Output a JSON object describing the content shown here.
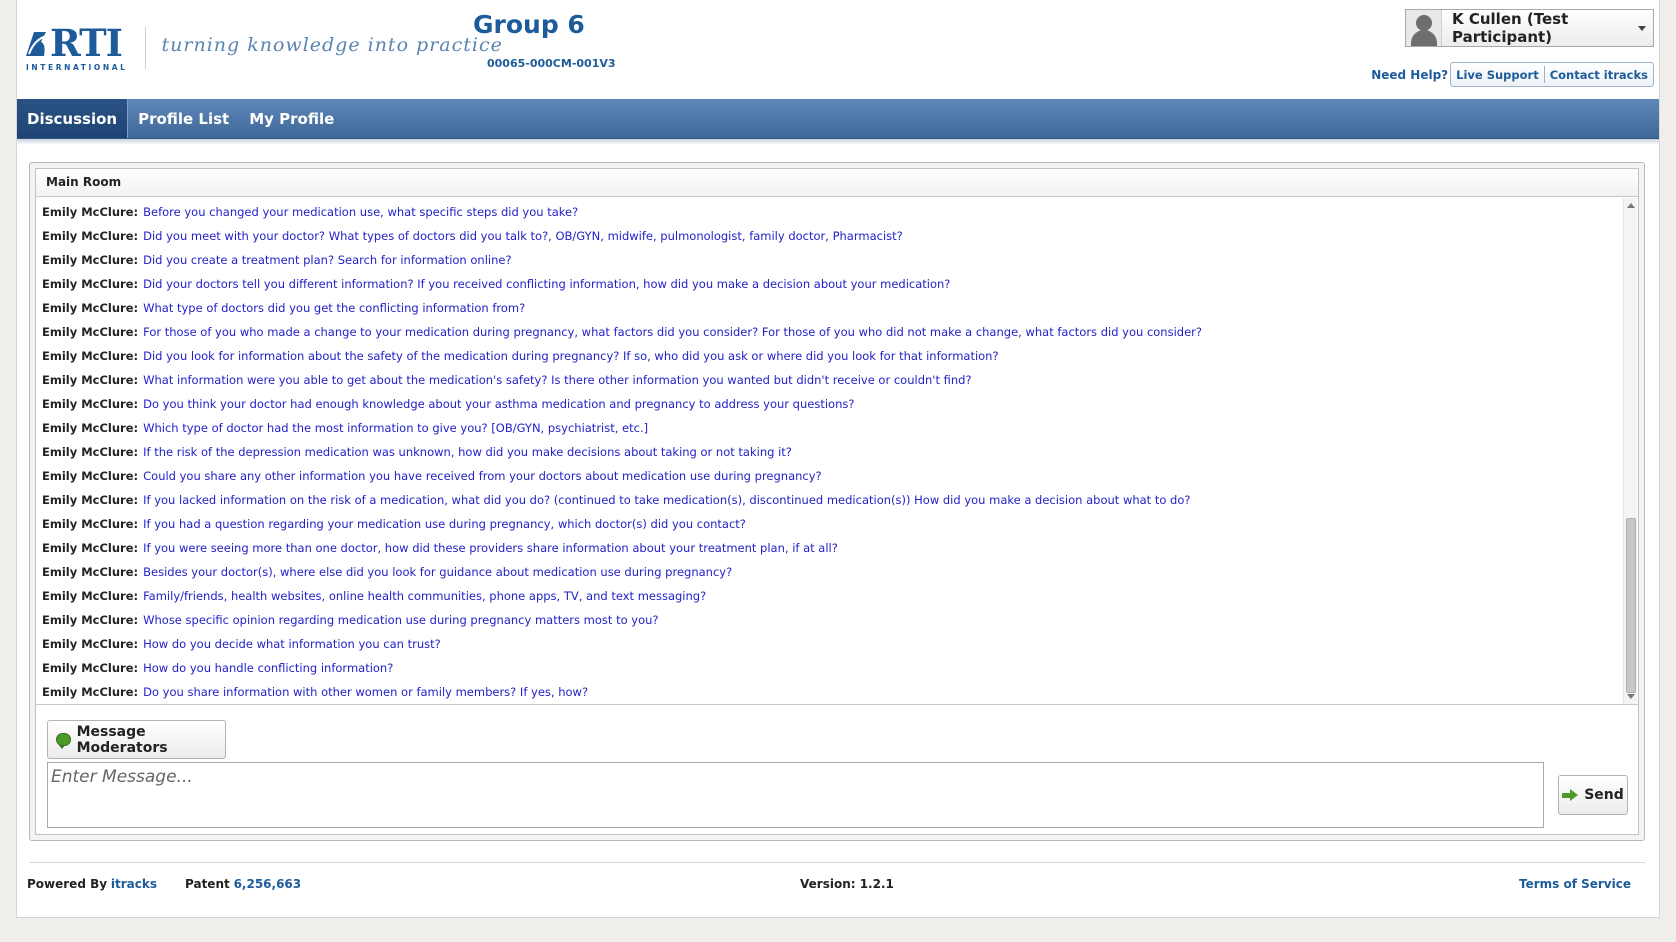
{
  "header": {
    "logo_text": "RTI",
    "logo_subtext": "INTERNATIONAL",
    "tagline": "turning knowledge into practice",
    "group_title": "Group 6",
    "group_code": "00065-000CM-001V3",
    "user_name": "K Cullen (Test Participant)",
    "need_help": "Need Help?",
    "live_support": "Live Support",
    "contact": "Contact itracks"
  },
  "nav": {
    "tabs": [
      {
        "label": "Discussion",
        "active": true
      },
      {
        "label": "Profile List",
        "active": false
      },
      {
        "label": "My Profile",
        "active": false
      }
    ]
  },
  "chat": {
    "room_title": "Main Room",
    "messages": [
      {
        "author": "Emily McClure:",
        "text": "Before you changed your medication use, what specific steps did you take?"
      },
      {
        "author": "Emily McClure:",
        "text": "Did you meet with your doctor? What types of doctors did you talk to?, OB/GYN, midwife, pulmonologist, family doctor, Pharmacist?"
      },
      {
        "author": "Emily McClure:",
        "text": "Did you create a treatment plan? Search for information online?"
      },
      {
        "author": "Emily McClure:",
        "text": "Did your doctors tell you different information? If you received conflicting information, how did you make a decision about your medication?"
      },
      {
        "author": "Emily McClure:",
        "text": "What type of doctors did you get the conflicting information from?"
      },
      {
        "author": "Emily McClure:",
        "text": "For those of you who made a change to your medication during pregnancy, what factors did you consider? For those of you who did not make a change, what factors did you consider?"
      },
      {
        "author": "Emily McClure:",
        "text": "Did you look for information about the safety of the medication during pregnancy? If so, who did you ask or where did you look for that information?"
      },
      {
        "author": "Emily McClure:",
        "text": "What information were you able to get about the medication's safety? Is there other information you wanted but didn't receive or couldn't find?"
      },
      {
        "author": "Emily McClure:",
        "text": "Do you think your doctor had enough knowledge about your asthma medication and pregnancy to address your questions?"
      },
      {
        "author": "Emily McClure:",
        "text": "Which type of doctor had the most information to give you? [OB/GYN, psychiatrist, etc.]"
      },
      {
        "author": "Emily McClure:",
        "text": "If the risk of the depression medication was unknown, how did you make decisions about taking or not taking it?"
      },
      {
        "author": "Emily McClure:",
        "text": "Could you share any other information you have received from your doctors about medication use during pregnancy?"
      },
      {
        "author": "Emily McClure:",
        "text": "If you lacked information on the risk of a medication, what did you do? (continued to take medication(s), discontinued medication(s)) How did you make a decision about what to do?"
      },
      {
        "author": "Emily McClure:",
        "text": "If you had a question regarding your medication use during pregnancy, which doctor(s) did you contact?"
      },
      {
        "author": "Emily McClure:",
        "text": "If you were seeing more than one doctor, how did these providers share information about your treatment plan, if at all?"
      },
      {
        "author": "Emily McClure:",
        "text": "Besides your doctor(s), where else did you look for guidance about medication use during pregnancy?"
      },
      {
        "author": "Emily McClure:",
        "text": "Family/friends, health websites, online health communities, phone apps, TV, and text messaging?"
      },
      {
        "author": "Emily McClure:",
        "text": "Whose specific opinion regarding medication use during pregnancy matters most to you?"
      },
      {
        "author": "Emily McClure:",
        "text": "How do you decide what information you can trust?"
      },
      {
        "author": "Emily McClure:",
        "text": "How do you handle conflicting information?"
      },
      {
        "author": "Emily McClure:",
        "text": "Do you share information with other women or family members? If yes, how?"
      }
    ],
    "message_moderators_label": "Message Moderators",
    "input_placeholder": "Enter Message...",
    "send_label": "Send"
  },
  "footer": {
    "powered_by_label": "Powered By",
    "powered_by_link": "itracks",
    "patent_label": "Patent",
    "patent_number": "6,256,663",
    "version_label": "Version: 1.2.1",
    "terms_label": "Terms of Service"
  },
  "colors": {
    "brand_blue": "#1d5b9b",
    "nav_blue": "#4f78a8",
    "message_text": "#2222c8",
    "accent_green": "#4c9a2a"
  }
}
